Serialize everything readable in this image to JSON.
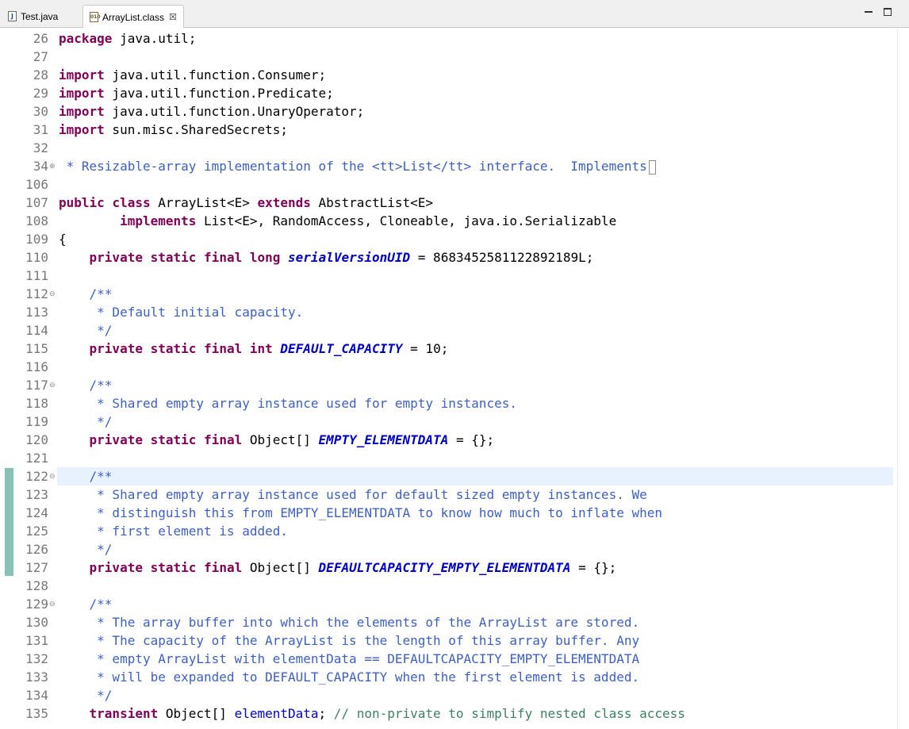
{
  "tabs": [
    {
      "label": "Test.java",
      "icon": "java-file-icon",
      "icon_glyph": "J"
    },
    {
      "label": "ArrayList.class",
      "icon": "class-file-icon",
      "icon_glyph": "010"
    }
  ],
  "close_glyph": "☒",
  "lines": [
    {
      "n": "26",
      "fold": "",
      "html": "<span class=\"kw\">package</span> java.util;"
    },
    {
      "n": "27",
      "fold": "",
      "html": ""
    },
    {
      "n": "28",
      "fold": "",
      "html": "<span class=\"kw\">import</span> java.util.function.Consumer;"
    },
    {
      "n": "29",
      "fold": "",
      "html": "<span class=\"kw\">import</span> java.util.function.Predicate;"
    },
    {
      "n": "30",
      "fold": "",
      "html": "<span class=\"kw\">import</span> java.util.function.UnaryOperator;"
    },
    {
      "n": "31",
      "fold": "",
      "html": "<span class=\"kw\">import</span> sun.misc.SharedSecrets;"
    },
    {
      "n": "32",
      "fold": "",
      "html": ""
    },
    {
      "n": "34",
      "fold": "⊕",
      "html": "<span class=\"jd\"> * Resizable-array implementation of the &lt;tt&gt;List&lt;/tt&gt; interface.  Implements</span><span class=\"fold-box\"></span>"
    },
    {
      "n": "106",
      "fold": "",
      "html": ""
    },
    {
      "n": "107",
      "fold": "",
      "html": "<span class=\"kw\">public</span> <span class=\"kw\">class</span> ArrayList&lt;E&gt; <span class=\"kw\">extends</span> AbstractList&lt;E&gt;"
    },
    {
      "n": "108",
      "fold": "",
      "html": "        <span class=\"kw\">implements</span> List&lt;E&gt;, RandomAccess, Cloneable, java.io.Serializable"
    },
    {
      "n": "109",
      "fold": "",
      "html": "{"
    },
    {
      "n": "110",
      "fold": "",
      "html": "    <span class=\"kw\">private</span> <span class=\"kw\">static</span> <span class=\"kw\">final</span> <span class=\"kw\">long</span> <span class=\"fs\">serialVersionUID</span> = 8683452581122892189L;"
    },
    {
      "n": "111",
      "fold": "",
      "html": ""
    },
    {
      "n": "112",
      "fold": "⊖",
      "html": "    <span class=\"jd\">/**</span>"
    },
    {
      "n": "113",
      "fold": "",
      "html": "<span class=\"jd\">     * Default initial capacity.</span>"
    },
    {
      "n": "114",
      "fold": "",
      "html": "<span class=\"jd\">     */</span>"
    },
    {
      "n": "115",
      "fold": "",
      "html": "    <span class=\"kw\">private</span> <span class=\"kw\">static</span> <span class=\"kw\">final</span> <span class=\"kw\">int</span> <span class=\"fs\">DEFAULT_CAPACITY</span> = 10;"
    },
    {
      "n": "116",
      "fold": "",
      "html": ""
    },
    {
      "n": "117",
      "fold": "⊖",
      "html": "    <span class=\"jd\">/**</span>"
    },
    {
      "n": "118",
      "fold": "",
      "html": "<span class=\"jd\">     * Shared empty array instance used for empty instances.</span>"
    },
    {
      "n": "119",
      "fold": "",
      "html": "<span class=\"jd\">     */</span>"
    },
    {
      "n": "120",
      "fold": "",
      "html": "    <span class=\"kw\">private</span> <span class=\"kw\">static</span> <span class=\"kw\">final</span> Object[] <span class=\"fs\">EMPTY_ELEMENTDATA</span> = {};"
    },
    {
      "n": "121",
      "fold": "",
      "html": ""
    },
    {
      "n": "122",
      "fold": "⊖",
      "html": "    <span class=\"jd\">/**</span>",
      "current": true
    },
    {
      "n": "123",
      "fold": "",
      "html": "<span class=\"jd\">     * Shared empty array instance used for default sized empty instances. We</span>"
    },
    {
      "n": "124",
      "fold": "",
      "html": "<span class=\"jd\">     * distinguish this from EMPTY_ELEMENTDATA to know how much to inflate when</span>"
    },
    {
      "n": "125",
      "fold": "",
      "html": "<span class=\"jd\">     * first element is added.</span>"
    },
    {
      "n": "126",
      "fold": "",
      "html": "<span class=\"jd\">     */</span>"
    },
    {
      "n": "127",
      "fold": "",
      "html": "    <span class=\"kw\">private</span> <span class=\"kw\">static</span> <span class=\"kw\">final</span> Object[] <span class=\"fs\">DEFAULTCAPACITY_EMPTY_ELEMENTDATA</span> = {};"
    },
    {
      "n": "128",
      "fold": "",
      "html": ""
    },
    {
      "n": "129",
      "fold": "⊖",
      "html": "    <span class=\"jd\">/**</span>"
    },
    {
      "n": "130",
      "fold": "",
      "html": "<span class=\"jd\">     * The array buffer into which the elements of the ArrayList are stored.</span>"
    },
    {
      "n": "131",
      "fold": "",
      "html": "<span class=\"jd\">     * The capacity of the ArrayList is the length of this array buffer. Any</span>"
    },
    {
      "n": "132",
      "fold": "",
      "html": "<span class=\"jd\">     * empty ArrayList with elementData == DEFAULTCAPACITY_EMPTY_ELEMENTDATA</span>"
    },
    {
      "n": "133",
      "fold": "",
      "html": "<span class=\"jd\">     * will be expanded to DEFAULT_CAPACITY when the first element is added.</span>"
    },
    {
      "n": "134",
      "fold": "",
      "html": "<span class=\"jd\">     */</span>"
    },
    {
      "n": "135",
      "fold": "",
      "html": "    <span class=\"kw\">transient</span> Object[] <span class=\"fi\">elementData</span>; <span class=\"cm\">// non-private to simplify nested class access</span>"
    }
  ],
  "colors": {
    "keyword": "#7f0055",
    "javadoc": "#3f5fbf",
    "comment": "#3f7f5f",
    "static_field": "#0000c0",
    "current_line": "#e8f2fe",
    "change_bar": "#86c2b6"
  }
}
